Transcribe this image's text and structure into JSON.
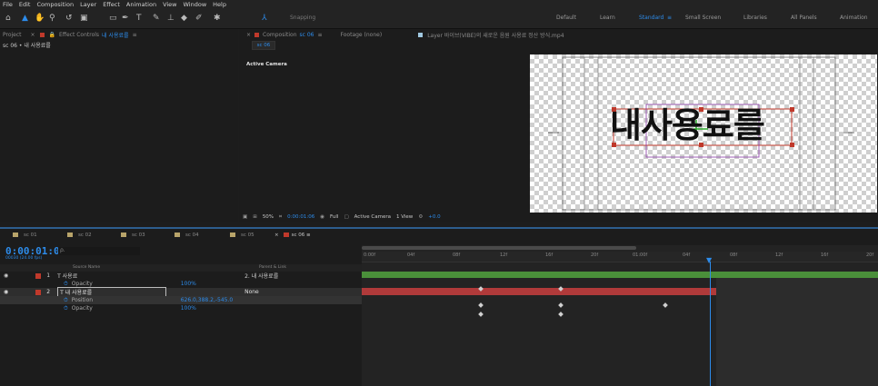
{
  "menu": [
    "File",
    "Edit",
    "Composition",
    "Layer",
    "Effect",
    "Animation",
    "View",
    "Window",
    "Help"
  ],
  "toolbar": {
    "snapping": "Snapping",
    "workspaces": [
      "Default",
      "Learn",
      "Standard",
      "Small Screen",
      "Libraries",
      "All Panels",
      "Animation"
    ],
    "active_workspace": "Standard"
  },
  "left_panel": {
    "tab_project": "Project",
    "tab_effect_controls": "Effect Controls",
    "effect_layer": "내 사용료를",
    "subtitle": "sc 06 • 내 사용료를"
  },
  "comp_panel": {
    "tab_composition": "Composition",
    "comp_name": "sc 06",
    "tab_footage": "Footage (none)",
    "tab_layer": "Layer 바이브(VIBE)의 새로운 음원 사용료 정산 방식.mp4",
    "active_camera_label": "Active Camera",
    "canvas_text": "내사용료를",
    "viewer_controls": {
      "zoom": "50%",
      "time": "0:00:01:06",
      "resolution": "Full",
      "camera": "Active Camera",
      "views": "1 View",
      "exposure": "+0.0"
    }
  },
  "timeline": {
    "tabs": [
      "sc 01",
      "sc 02",
      "sc 03",
      "sc 04",
      "sc 05",
      "sc 06"
    ],
    "active_tab": "sc 06",
    "timecode": "0:00:01:06",
    "fps": "00030 (24.00 fps)",
    "search_placeholder": "ρ.",
    "col_source": "Source Name",
    "col_parent": "Parent & Link",
    "rows": [
      {
        "num": "1",
        "name": "T  사용료",
        "parent": "2. 내 사용료를"
      },
      {
        "prop": "Opacity",
        "value": "100%"
      },
      {
        "num": "2",
        "name": "T  내 사용료를",
        "parent": "None"
      },
      {
        "prop": "Position",
        "value": "626.0,388.2,-545.0"
      },
      {
        "prop": "Opacity",
        "value": "100%"
      }
    ],
    "ruler": [
      "0:00f",
      "04f",
      "08f",
      "12f",
      "16f",
      "20f",
      "01:00f",
      "04f",
      "08f",
      "12f",
      "16f",
      "20f"
    ],
    "colors": {
      "accent": "#2d8ceb",
      "layer1": "#4a8f3a",
      "layer2": "#b03a3a"
    }
  }
}
